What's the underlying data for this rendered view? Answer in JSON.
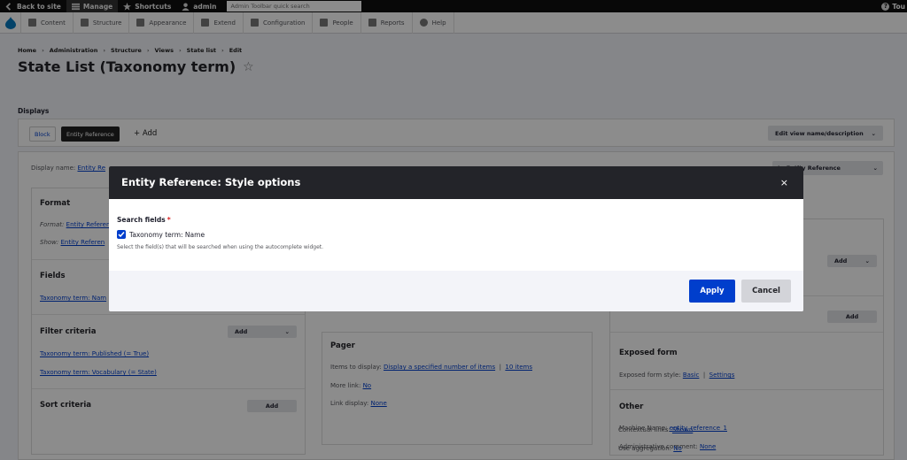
{
  "toolbar": {
    "back_to_site": "Back to site",
    "manage": "Manage",
    "shortcuts": "Shortcuts",
    "user": "admin",
    "search_placeholder": "Admin Toolbar quick search",
    "right_label": "Tou"
  },
  "tray": {
    "items": [
      {
        "label": "Content",
        "icon": "content-icon"
      },
      {
        "label": "Structure",
        "icon": "structure-icon"
      },
      {
        "label": "Appearance",
        "icon": "appearance-icon"
      },
      {
        "label": "Extend",
        "icon": "extend-icon"
      },
      {
        "label": "Configuration",
        "icon": "configuration-icon"
      },
      {
        "label": "People",
        "icon": "people-icon"
      },
      {
        "label": "Reports",
        "icon": "reports-icon"
      },
      {
        "label": "Help",
        "icon": "help-icon"
      }
    ]
  },
  "breadcrumb": [
    "Home",
    "Administration",
    "Structure",
    "Views",
    "State list",
    "Edit"
  ],
  "page": {
    "title": "State List (Taxonomy term)",
    "star": "☆",
    "displays_label": "Displays"
  },
  "displays": {
    "block_tab": "Block",
    "er_tab": "Entity Reference",
    "add": "+ Add",
    "edit_view": "Edit view name/description",
    "display_name_label": "Display name:",
    "display_name_value": "Entity Re",
    "duplicate": "te Entity Reference"
  },
  "left_col": {
    "format_title": "Format",
    "format_label": "Format:",
    "format_value": "Entity Referen",
    "show_label": "Show:",
    "show_value": "Entity Referen",
    "fields_title": "Fields",
    "fields_item": "Taxonomy term: Nam",
    "filter_title": "Filter criteria",
    "filter_add": "Add",
    "filter_items": [
      "Taxonomy term: Published (= True)",
      "Taxonomy term: Vocabulary (= State)"
    ],
    "sort_title": "Sort criteria",
    "sort_add": "Add"
  },
  "mid_col": {
    "pager_title": "Pager",
    "items_label": "Items to display:",
    "items_value": "Display a specified number of items",
    "items_sep": "|",
    "items_count": "10 items",
    "more_label": "More link:",
    "more_value": "No",
    "link_label": "Link display:",
    "link_value": "None"
  },
  "right_col": {
    "add_1": "Add",
    "add_2": "Add",
    "exposed_title": "Exposed form",
    "exposed_style_label": "Exposed form style:",
    "exposed_style_value": "Basic",
    "exposed_sep": "|",
    "exposed_settings": "Settings",
    "other_title": "Other",
    "machine_label": "Machine Name:",
    "machine_value": "entity_reference_1",
    "admin_comment_label": "Administrative comment:",
    "admin_comment_value": "None",
    "contextual_label": "Contextual links:",
    "contextual_value": "Shown",
    "aggregation_label": "Use aggregation:",
    "aggregation_value": "No"
  },
  "dialog": {
    "title": "Entity Reference: Style options",
    "close": "×",
    "field_label": "Search fields",
    "required_mark": "*",
    "checkbox_label": "Taxonomy term: Name",
    "checkbox_checked": true,
    "description": "Select the field(s) that will be searched when using the autocomplete widget.",
    "apply": "Apply",
    "cancel": "Cancel"
  },
  "colors": {
    "accent": "#003ecc",
    "dialog_header": "#232429",
    "toolbar": "#0f0f0f"
  }
}
